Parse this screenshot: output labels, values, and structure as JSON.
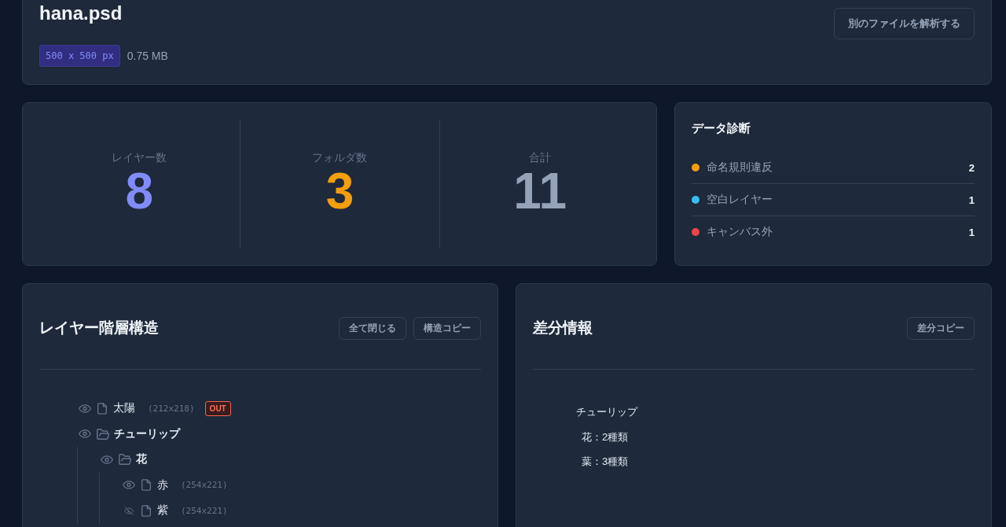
{
  "file": {
    "name": "hana.psd",
    "dimensions": "500 x 500 px",
    "size": "0.75 MB",
    "analyze_button": "別のファイルを解析する"
  },
  "stats": [
    {
      "label": "レイヤー数",
      "value": "8",
      "color": "#818cf8"
    },
    {
      "label": "フォルダ数",
      "value": "3",
      "color": "#f59e0b"
    },
    {
      "label": "合計",
      "value": "11",
      "color": "#94a3b8"
    }
  ],
  "diagnostics": {
    "title": "データ診断",
    "items": [
      {
        "label": "命名規則違反",
        "count": "2",
        "color": "#f59e0b"
      },
      {
        "label": "空白レイヤー",
        "count": "1",
        "color": "#38bdf8"
      },
      {
        "label": "キャンバス外",
        "count": "1",
        "color": "#ef4444"
      }
    ]
  },
  "layer_tree": {
    "title": "レイヤー階層構造",
    "buttons": [
      "全て閉じる",
      "構造コピー"
    ],
    "items": [
      {
        "kind": "layer",
        "name": "太陽",
        "size": "(212x218)",
        "visible": true,
        "badge": "OUT"
      },
      {
        "kind": "folder",
        "name": "チューリップ",
        "visible": true,
        "expanded": true,
        "children": [
          {
            "kind": "folder",
            "name": "花",
            "visible": true,
            "expanded": true,
            "children": [
              {
                "kind": "layer",
                "name": "赤",
                "size": "(254x221)",
                "visible": true
              },
              {
                "kind": "layer",
                "name": "紫",
                "size": "(254x221)",
                "visible": false
              }
            ]
          }
        ]
      }
    ]
  },
  "diff_info": {
    "title": "差分情報",
    "button": "差分コピー",
    "groups": [
      {
        "name": "チューリップ",
        "lines": [
          "花：2種類",
          "葉：3種類"
        ]
      }
    ]
  }
}
